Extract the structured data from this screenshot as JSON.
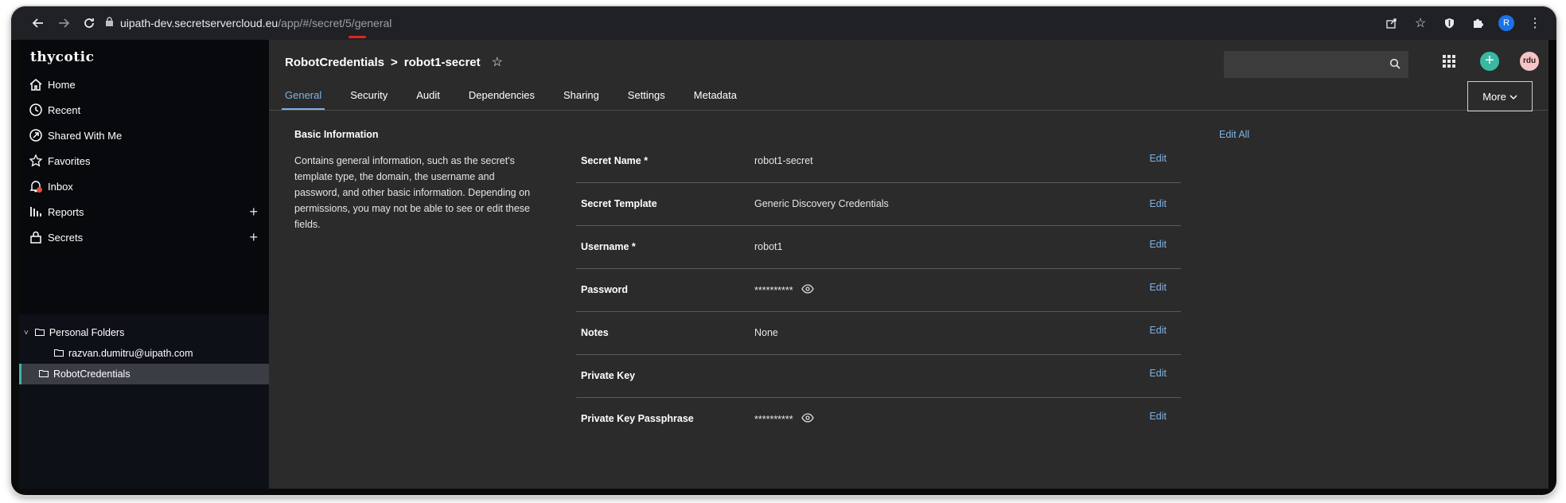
{
  "browser": {
    "url_host": "uipath-dev.secretservercloud.eu",
    "url_path": "/app/#/secret/5/general",
    "profile_initial": "R"
  },
  "sidebar": {
    "logo": "thycotic",
    "items": [
      {
        "label": "Home",
        "icon": "home-icon"
      },
      {
        "label": "Recent",
        "icon": "clock-icon"
      },
      {
        "label": "Shared With Me",
        "icon": "shared-icon"
      },
      {
        "label": "Favorites",
        "icon": "star-icon"
      },
      {
        "label": "Inbox",
        "icon": "bell-icon"
      },
      {
        "label": "Reports",
        "icon": "reports-icon"
      },
      {
        "label": "Secrets",
        "icon": "lock-icon"
      }
    ],
    "tree": [
      {
        "label": "Personal Folders"
      },
      {
        "label": "razvan.dumitru@uipath.com"
      },
      {
        "label": "RobotCredentials"
      }
    ]
  },
  "header": {
    "breadcrumb_parent": "RobotCredentials",
    "breadcrumb_sep": ">",
    "breadcrumb_current": "robot1-secret",
    "avatar_initials": "rdu"
  },
  "tabs": [
    {
      "label": "General",
      "active": true
    },
    {
      "label": "Security"
    },
    {
      "label": "Audit"
    },
    {
      "label": "Dependencies"
    },
    {
      "label": "Sharing"
    },
    {
      "label": "Settings"
    },
    {
      "label": "Metadata"
    }
  ],
  "more_label": "More",
  "basic_info": {
    "title": "Basic Information",
    "edit_all": "Edit All",
    "description": "Contains general information, such as the secret's template type, the domain, the username and password, and other basic information. Depending on permissions, you may not be able to see or edit these fields.",
    "fields": [
      {
        "label": "Secret Name *",
        "value": "robot1-secret",
        "edit": "Edit"
      },
      {
        "label": "Secret Template",
        "value": "Generic Discovery Credentials",
        "edit": "Edit"
      },
      {
        "label": "Username *",
        "value": "robot1",
        "edit": "Edit"
      },
      {
        "label": "Password",
        "value": "**********",
        "edit": "Edit",
        "reveal": true
      },
      {
        "label": "Notes",
        "value": "None",
        "edit": "Edit"
      },
      {
        "label": "Private Key",
        "value": "",
        "edit": "Edit"
      },
      {
        "label": "Private Key Passphrase",
        "value": "**********",
        "edit": "Edit",
        "reveal": true
      }
    ]
  },
  "colors": {
    "accent": "#39b8a4",
    "link": "#7fb2e5",
    "sidebar_bg": "#08090c",
    "main_bg": "#2b2b2b"
  }
}
